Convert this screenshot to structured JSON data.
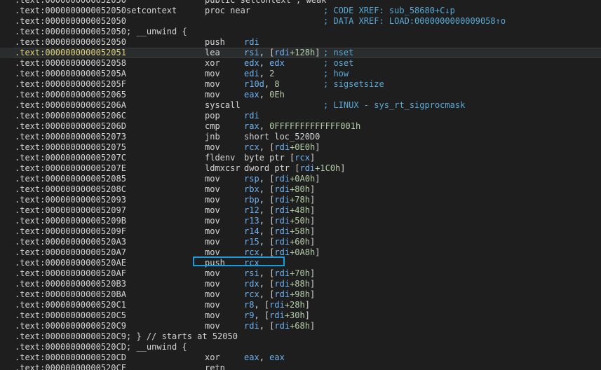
{
  "lines": [
    {
      "addr": ".text:0000000000052050",
      "mn": "public setcontext ; weak",
      "kind": "partial"
    },
    {
      "addr": ".text:0000000000052050",
      "label": "setcontext",
      "mn": "proc near",
      "cm": "; CODE XREF: sub_58680+C↓p"
    },
    {
      "addr": ".text:0000000000052050",
      "cm": "; DATA XREF: LOAD:0000000000009058↑o"
    },
    {
      "addr": ".text:0000000000052050",
      "braces": "; __unwind {"
    },
    {
      "addr": ".text:0000000000052050",
      "mn": "push",
      "ops": [
        [
          "rdi",
          "reg"
        ]
      ]
    },
    {
      "addr": ".text:0000000000052051",
      "mn": "lea",
      "ops": [
        [
          "rsi",
          "reg"
        ],
        [
          ", [",
          "p"
        ],
        [
          "rdi",
          "reg"
        ],
        [
          "+128h",
          "num"
        ],
        [
          "]",
          "p"
        ]
      ],
      "cm": "; nset",
      "cur": true
    },
    {
      "addr": ".text:0000000000052058",
      "mn": "xor",
      "ops": [
        [
          "edx",
          "reg"
        ],
        [
          ", ",
          "p"
        ],
        [
          "edx",
          "reg"
        ]
      ],
      "cm": "; oset"
    },
    {
      "addr": ".text:000000000005205A",
      "mn": "mov",
      "ops": [
        [
          "edi",
          "reg"
        ],
        [
          ", ",
          "p"
        ],
        [
          "2",
          "num"
        ]
      ],
      "cm": "; how"
    },
    {
      "addr": ".text:000000000005205F",
      "mn": "mov",
      "ops": [
        [
          "r10d",
          "reg"
        ],
        [
          ", ",
          "p"
        ],
        [
          "8",
          "num"
        ]
      ],
      "cm": "; sigsetsize"
    },
    {
      "addr": ".text:0000000000052065",
      "mn": "mov",
      "ops": [
        [
          "eax",
          "reg"
        ],
        [
          ", ",
          "p"
        ],
        [
          "0Eh",
          "num"
        ]
      ]
    },
    {
      "addr": ".text:000000000005206A",
      "mn": "syscall",
      "cm": "; LINUX - sys_rt_sigprocmask"
    },
    {
      "addr": ".text:000000000005206C",
      "mn": "pop",
      "ops": [
        [
          "rdi",
          "reg"
        ]
      ]
    },
    {
      "addr": ".text:000000000005206D",
      "mn": "cmp",
      "ops": [
        [
          "rax",
          "reg"
        ],
        [
          ", ",
          "p"
        ],
        [
          "0FFFFFFFFFFFFF001h",
          "num"
        ]
      ]
    },
    {
      "addr": ".text:0000000000052073",
      "mn": "jnb",
      "ops": [
        [
          "short loc_520D0",
          "p"
        ]
      ]
    },
    {
      "addr": ".text:0000000000052075",
      "mn": "mov",
      "ops": [
        [
          "rcx",
          "reg"
        ],
        [
          ", [",
          "p"
        ],
        [
          "rdi",
          "reg"
        ],
        [
          "+0E0h",
          "num"
        ],
        [
          "]",
          "p"
        ]
      ]
    },
    {
      "addr": ".text:000000000005207C",
      "mn": "fldenv",
      "ops": [
        [
          "byte ptr [",
          "p"
        ],
        [
          "rcx",
          "reg"
        ],
        [
          "]",
          "p"
        ]
      ]
    },
    {
      "addr": ".text:000000000005207E",
      "mn": "ldmxcsr",
      "ops": [
        [
          "dword ptr [",
          "p"
        ],
        [
          "rdi",
          "reg"
        ],
        [
          "+1C0h",
          "num"
        ],
        [
          "]",
          "p"
        ]
      ]
    },
    {
      "addr": ".text:0000000000052085",
      "mn": "mov",
      "ops": [
        [
          "rsp",
          "reg"
        ],
        [
          ", [",
          "p"
        ],
        [
          "rdi",
          "reg"
        ],
        [
          "+0A0h",
          "num"
        ],
        [
          "]",
          "p"
        ]
      ]
    },
    {
      "addr": ".text:000000000005208C",
      "mn": "mov",
      "ops": [
        [
          "rbx",
          "reg"
        ],
        [
          ", [",
          "p"
        ],
        [
          "rdi",
          "reg"
        ],
        [
          "+80h",
          "num"
        ],
        [
          "]",
          "p"
        ]
      ]
    },
    {
      "addr": ".text:0000000000052093",
      "mn": "mov",
      "ops": [
        [
          "rbp",
          "reg"
        ],
        [
          ", [",
          "p"
        ],
        [
          "rdi",
          "reg"
        ],
        [
          "+78h",
          "num"
        ],
        [
          "]",
          "p"
        ]
      ]
    },
    {
      "addr": ".text:0000000000052097",
      "mn": "mov",
      "ops": [
        [
          "r12",
          "reg"
        ],
        [
          ", [",
          "p"
        ],
        [
          "rdi",
          "reg"
        ],
        [
          "+48h",
          "num"
        ],
        [
          "]",
          "p"
        ]
      ]
    },
    {
      "addr": ".text:000000000005209B",
      "mn": "mov",
      "ops": [
        [
          "r13",
          "reg"
        ],
        [
          ", [",
          "p"
        ],
        [
          "rdi",
          "reg"
        ],
        [
          "+50h",
          "num"
        ],
        [
          "]",
          "p"
        ]
      ]
    },
    {
      "addr": ".text:000000000005209F",
      "mn": "mov",
      "ops": [
        [
          "r14",
          "reg"
        ],
        [
          ", [",
          "p"
        ],
        [
          "rdi",
          "reg"
        ],
        [
          "+58h",
          "num"
        ],
        [
          "]",
          "p"
        ]
      ]
    },
    {
      "addr": ".text:00000000000520A3",
      "mn": "mov",
      "ops": [
        [
          "r15",
          "reg"
        ],
        [
          ", [",
          "p"
        ],
        [
          "rdi",
          "reg"
        ],
        [
          "+60h",
          "num"
        ],
        [
          "]",
          "p"
        ]
      ]
    },
    {
      "addr": ".text:00000000000520A7",
      "mn": "mov",
      "ops": [
        [
          "rcx",
          "reg"
        ],
        [
          ", [",
          "p"
        ],
        [
          "rdi",
          "reg"
        ],
        [
          "+0A8h",
          "num"
        ],
        [
          "]",
          "p"
        ]
      ]
    },
    {
      "addr": ".text:00000000000520AE",
      "mn": "push",
      "ops": [
        [
          "rcx",
          "reg"
        ]
      ],
      "boxed": true
    },
    {
      "addr": ".text:00000000000520AF",
      "mn": "mov",
      "ops": [
        [
          "rsi",
          "reg"
        ],
        [
          ", [",
          "p"
        ],
        [
          "rdi",
          "reg"
        ],
        [
          "+70h",
          "num"
        ],
        [
          "]",
          "p"
        ]
      ]
    },
    {
      "addr": ".text:00000000000520B3",
      "mn": "mov",
      "ops": [
        [
          "rdx",
          "reg"
        ],
        [
          ", [",
          "p"
        ],
        [
          "rdi",
          "reg"
        ],
        [
          "+88h",
          "num"
        ],
        [
          "]",
          "p"
        ]
      ]
    },
    {
      "addr": ".text:00000000000520BA",
      "mn": "mov",
      "ops": [
        [
          "rcx",
          "reg"
        ],
        [
          ", [",
          "p"
        ],
        [
          "rdi",
          "reg"
        ],
        [
          "+98h",
          "num"
        ],
        [
          "]",
          "p"
        ]
      ]
    },
    {
      "addr": ".text:00000000000520C1",
      "mn": "mov",
      "ops": [
        [
          "r8",
          "reg"
        ],
        [
          ", [",
          "p"
        ],
        [
          "rdi",
          "reg"
        ],
        [
          "+28h",
          "num"
        ],
        [
          "]",
          "p"
        ]
      ]
    },
    {
      "addr": ".text:00000000000520C5",
      "mn": "mov",
      "ops": [
        [
          "r9",
          "reg"
        ],
        [
          ", [",
          "p"
        ],
        [
          "rdi",
          "reg"
        ],
        [
          "+30h",
          "num"
        ],
        [
          "]",
          "p"
        ]
      ]
    },
    {
      "addr": ".text:00000000000520C9",
      "mn": "mov",
      "ops": [
        [
          "rdi",
          "reg"
        ],
        [
          ", [",
          "p"
        ],
        [
          "rdi",
          "reg"
        ],
        [
          "+68h",
          "num"
        ],
        [
          "]",
          "p"
        ]
      ]
    },
    {
      "addr": ".text:00000000000520C9",
      "braces": "; } // starts at 52050"
    },
    {
      "addr": ".text:00000000000520CD",
      "braces": "; __unwind {"
    },
    {
      "addr": ".text:00000000000520CD",
      "mn": "xor",
      "ops": [
        [
          "eax",
          "reg"
        ],
        [
          ", ",
          "p"
        ],
        [
          "eax",
          "reg"
        ]
      ]
    },
    {
      "addr": ".text:00000000000520CF",
      "mn": "retn"
    }
  ],
  "colors": {
    "background": "#1e1e1e",
    "register": "#6fb3f2",
    "comment": "#5aa9d6",
    "selection_box": "#1a9bdc"
  }
}
